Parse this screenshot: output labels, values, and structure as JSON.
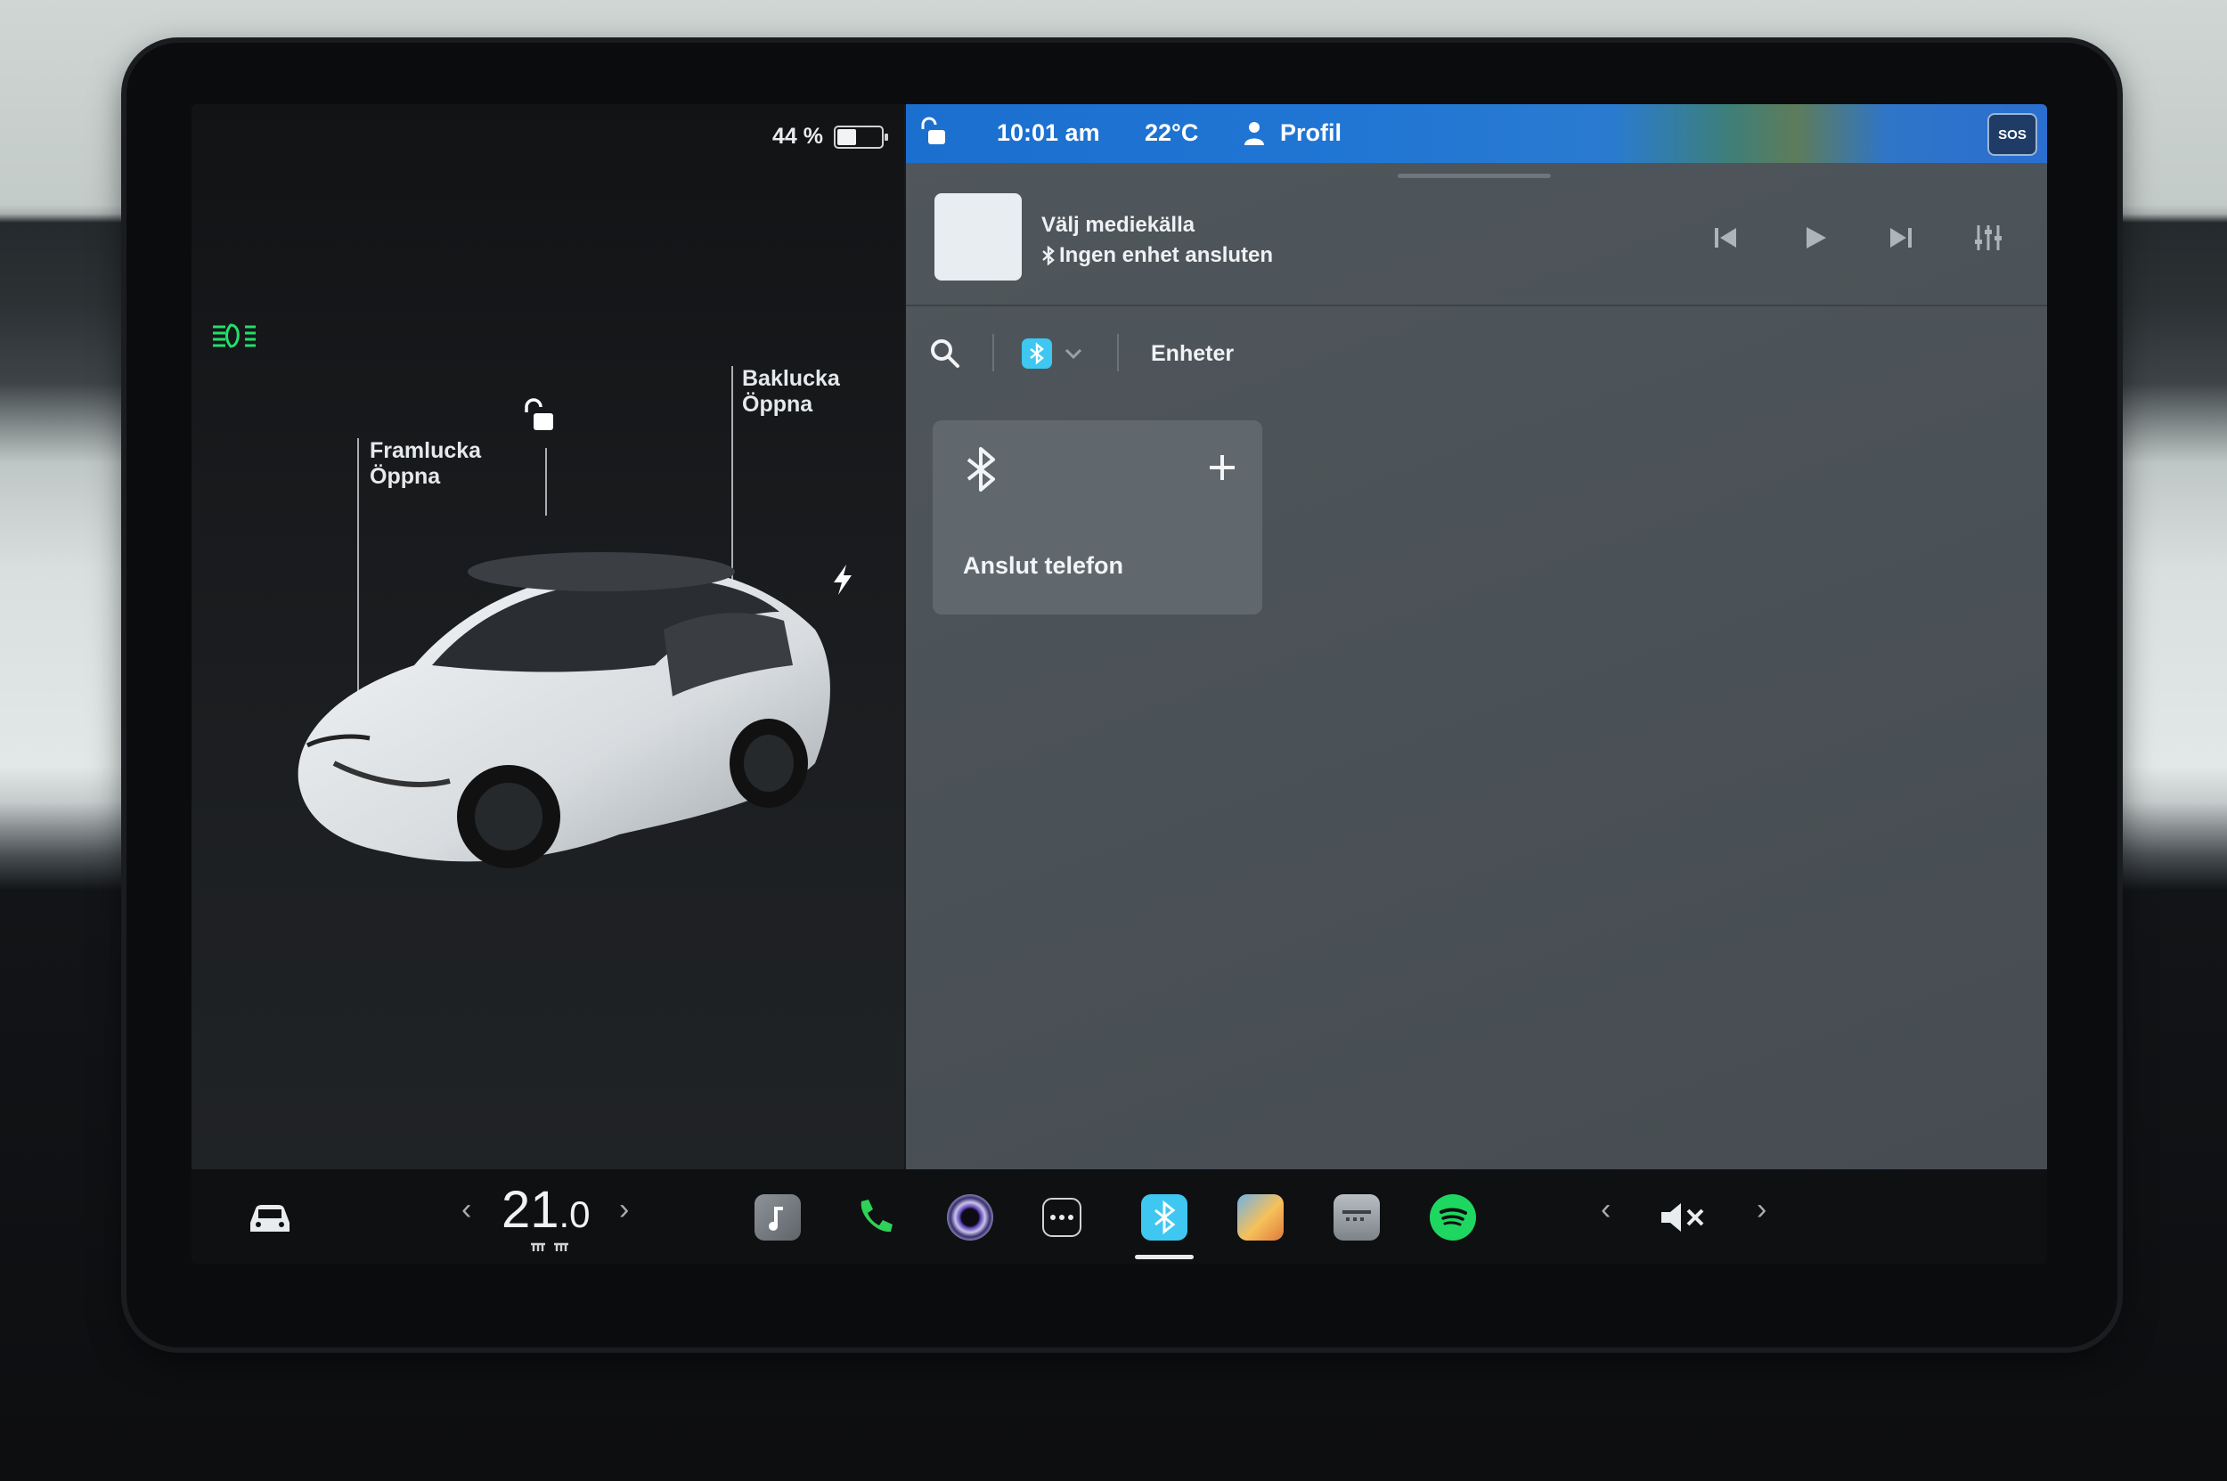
{
  "status": {
    "battery_percent": "44 %",
    "battery_level": 0.44,
    "time": "10:01 am",
    "temperature": "22°C",
    "profile_label": "Profil",
    "sos_label": "SOS"
  },
  "car": {
    "trunk_title": "Baklucka",
    "trunk_action": "Öppna",
    "frunk_title": "Framlucka",
    "frunk_action": "Öppna"
  },
  "media": {
    "title": "Välj mediekälla",
    "subtitle": "Ingen enhet ansluten"
  },
  "bluetooth": {
    "devices_label": "Enheter",
    "connect_phone_label": "Anslut telefon"
  },
  "dock": {
    "cabin_temp_int": "21",
    "cabin_temp_dec": ".0",
    "prev_arrow": "‹",
    "next_arrow": "›"
  },
  "colors": {
    "headlight_green": "#22e06a",
    "bluetooth_blue": "#3ec7f0",
    "phone_green": "#2fd158",
    "spotify_green": "#1ed760"
  }
}
